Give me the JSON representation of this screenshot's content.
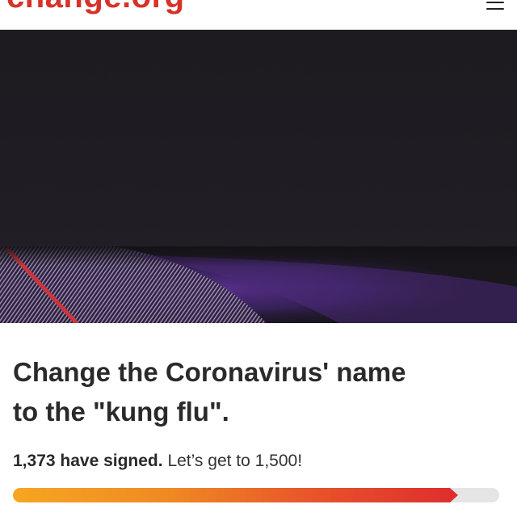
{
  "header": {
    "logo_text": "change.org",
    "menu_icon": "hamburger-menu-icon"
  },
  "petition": {
    "title_line1": "Change the Coronavirus' name",
    "title_line2": "to the \"kung flu\".",
    "signed_count": "1,373 have signed.",
    "goal_text": "Let’s get to 1,500!",
    "signatures": 1373,
    "goal": 1500,
    "progress_fraction": 0.915
  },
  "colors": {
    "brand": "#d7322a",
    "progress_start": "#f6a623",
    "progress_end": "#de2f2d",
    "track": "#e5e5e5"
  }
}
